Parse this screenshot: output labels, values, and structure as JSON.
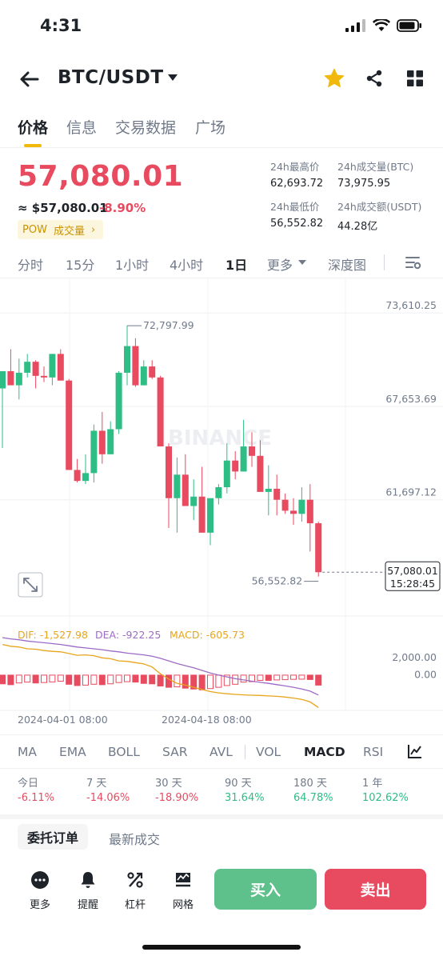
{
  "status": {
    "time": "4:31"
  },
  "header": {
    "pair": "BTC/USDT",
    "icons": [
      "back-arrow-icon",
      "chevron-down-icon",
      "star-icon",
      "share-icon",
      "apps-grid-icon"
    ]
  },
  "tabs": [
    {
      "label": "价格",
      "active": true
    },
    {
      "label": "信息",
      "active": false
    },
    {
      "label": "交易数据",
      "active": false
    },
    {
      "label": "广场",
      "active": false
    }
  ],
  "price": {
    "last": "57,080.01",
    "approx": "≈ $57,080.01",
    "change": "-8.90%",
    "tag_pow": "POW",
    "tag_volume": "成交量",
    "tag_arrow": "›"
  },
  "stats": {
    "high_label": "24h最高价",
    "high_value": "62,693.72",
    "vol_btc_label": "24h成交量(BTC)",
    "vol_btc_value": "73,975.95",
    "low_label": "24h最低价",
    "low_value": "56,552.82",
    "vol_usdt_label": "24h成交额(USDT)",
    "vol_usdt_value": "44.28亿"
  },
  "intervals": [
    {
      "label": "分时",
      "active": false
    },
    {
      "label": "15分",
      "active": false
    },
    {
      "label": "1小时",
      "active": false
    },
    {
      "label": "4小时",
      "active": false
    },
    {
      "label": "1日",
      "active": true
    },
    {
      "label": "更多",
      "active": false
    },
    {
      "label": "深度图",
      "active": false
    }
  ],
  "chart_data": {
    "type": "candlestick",
    "interval": "1日",
    "y_ticks": [
      "73,610.25",
      "67,653.69",
      "61,697.12"
    ],
    "ylim": [
      55000,
      75000
    ],
    "annot_high": "72,797.99",
    "annot_low": "56,552.82",
    "last_price": "57,080.01",
    "countdown": "15:28:45",
    "x_labels": [
      "2024-04-01 08:00",
      "2024-04-18 08:00"
    ],
    "watermark": "BINANCE",
    "colors": {
      "up": "#2ebd85",
      "down": "#e84a5f",
      "dif": "#e7a51c",
      "dea": "#9d6bc6"
    },
    "candles": [
      [
        68800,
        69900,
        65000,
        69900
      ],
      [
        69900,
        71300,
        69200,
        69000
      ],
      [
        69000,
        70700,
        68100,
        69800
      ],
      [
        69800,
        71000,
        69500,
        70500
      ],
      [
        70500,
        70600,
        68800,
        69600
      ],
      [
        69600,
        70200,
        69200,
        69500
      ],
      [
        69500,
        71000,
        69000,
        71000
      ],
      [
        71000,
        71300,
        69600,
        69300
      ],
      [
        69300,
        69400,
        63700,
        63600
      ],
      [
        63600,
        64300,
        62800,
        62900
      ],
      [
        62900,
        64600,
        62700,
        63400
      ],
      [
        63400,
        66500,
        62800,
        66100
      ],
      [
        66100,
        67300,
        64000,
        64600
      ],
      [
        64600,
        66700,
        64600,
        66200
      ],
      [
        66200,
        69900,
        65900,
        69800
      ],
      [
        69800,
        72800,
        69000,
        71500
      ],
      [
        71500,
        72000,
        68900,
        69000
      ],
      [
        69000,
        70600,
        69000,
        70200
      ],
      [
        70200,
        70600,
        69400,
        69500
      ],
      [
        69500,
        69600,
        65100,
        65100
      ],
      [
        65100,
        65300,
        59900,
        61800
      ],
      [
        61800,
        64400,
        59600,
        63300
      ],
      [
        63300,
        64600,
        62100,
        61300
      ],
      [
        61300,
        63000,
        60400,
        61900
      ],
      [
        61900,
        63800,
        60900,
        59600
      ],
      [
        59600,
        61500,
        58800,
        61800
      ],
      [
        61800,
        62700,
        61400,
        62500
      ],
      [
        62500,
        65300,
        62100,
        64200
      ],
      [
        64200,
        64800,
        63000,
        63500
      ],
      [
        63500,
        66800,
        63500,
        65100
      ],
      [
        65100,
        66000,
        63800,
        64500
      ],
      [
        64500,
        65500,
        62400,
        62200
      ],
      [
        62200,
        63900,
        60700,
        62400
      ],
      [
        62400,
        63300,
        60700,
        61700
      ],
      [
        61700,
        62100,
        60800,
        61000
      ],
      [
        61000,
        61800,
        60100,
        60800
      ],
      [
        60800,
        62500,
        60300,
        61700
      ],
      [
        61700,
        62700,
        58400,
        60200
      ],
      [
        60200,
        60300,
        56800,
        57080
      ]
    ],
    "macd": {
      "dif": "-1,527.98",
      "dea": "-922.25",
      "macd": "-605.73",
      "y_ticks": [
        "2,000.00",
        "0.00"
      ],
      "hist": [
        -1100,
        -1200,
        -1000,
        -900,
        -1000,
        -950,
        -880,
        -800,
        -1150,
        -1300,
        -1250,
        -1150,
        -1200,
        -1100,
        -950,
        -850,
        -900,
        -1050,
        -1100,
        -1350,
        -1500,
        -1450,
        -1600,
        -1700,
        -1800,
        -1650,
        -1500,
        -1300,
        -1150,
        -900,
        -850,
        -700,
        -700,
        -650,
        -620,
        -580,
        -560,
        -600,
        -1250
      ],
      "dif_series": [
        3500,
        3300,
        3200,
        3000,
        2950,
        2800,
        2700,
        2650,
        2450,
        2250,
        2300,
        2200,
        1950,
        1850,
        1600,
        1550,
        1400,
        1250,
        900,
        100,
        -500,
        -1000,
        -1200,
        -1450,
        -1700,
        -1950,
        -2100,
        -2200,
        -2280,
        -2330,
        -2370,
        -2400,
        -2450,
        -2500,
        -2580,
        -2700,
        -2850,
        -3150,
        -3800
      ],
      "dea_series": [
        4300,
        4150,
        4050,
        3900,
        3800,
        3700,
        3600,
        3500,
        3350,
        3200,
        3100,
        3000,
        2900,
        2750,
        2650,
        2500,
        2400,
        2300,
        2150,
        1900,
        1600,
        1300,
        1050,
        800,
        500,
        200,
        -50,
        -250,
        -450,
        -600,
        -750,
        -880,
        -1000,
        -1150,
        -1300,
        -1450,
        -1650,
        -1900,
        -2350
      ],
      "ylim": [
        -4500,
        5500
      ]
    }
  },
  "indicators": [
    {
      "label": "MA",
      "active": false
    },
    {
      "label": "EMA",
      "active": false
    },
    {
      "label": "BOLL",
      "active": false
    },
    {
      "label": "SAR",
      "active": false
    },
    {
      "label": "AVL",
      "active": false
    },
    {
      "label": "VOL",
      "active": false
    },
    {
      "label": "MACD",
      "active": true
    },
    {
      "label": "RSI",
      "active": false
    }
  ],
  "performance": [
    {
      "label": "今日",
      "value": "-6.11%",
      "sign": "neg"
    },
    {
      "label": "7 天",
      "value": "-14.06%",
      "sign": "neg"
    },
    {
      "label": "30 天",
      "value": "-18.90%",
      "sign": "neg"
    },
    {
      "label": "90 天",
      "value": "31.64%",
      "sign": "pos"
    },
    {
      "label": "180 天",
      "value": "64.78%",
      "sign": "pos"
    },
    {
      "label": "1 年",
      "value": "102.62%",
      "sign": "pos"
    }
  ],
  "orders": {
    "tab_orders": "委托订单",
    "tab_trades": "最新成交"
  },
  "bottom": {
    "more": "更多",
    "alert": "提醒",
    "leverage": "杠杆",
    "grid": "网格",
    "buy": "买入",
    "sell": "卖出"
  }
}
